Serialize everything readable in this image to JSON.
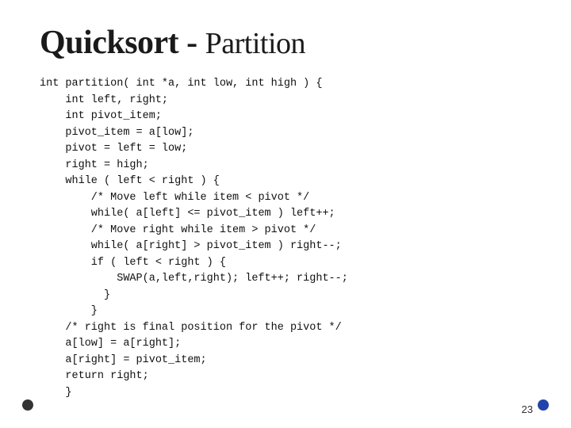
{
  "slide": {
    "title": "Quicksort - ",
    "title_part2": "Partition",
    "code": "int partition( int *a, int low, int high ) {\n    int left, right;\n    int pivot_item;\n    pivot_item = a[low];\n    pivot = left = low;\n    right = high;\n    while ( left < right ) {\n        /* Move left while item < pivot */\n        while( a[left] <= pivot_item ) left++;\n        /* Move right while item > pivot */\n        while( a[right] > pivot_item ) right--;\n        if ( left < right ) {\n            SWAP(a,left,right); left++; right--;\n          }\n        }\n    /* right is final position for the pivot */\n    a[low] = a[right];\n    a[right] = pivot_item;\n    return right;\n    }",
    "page_number": "23"
  }
}
